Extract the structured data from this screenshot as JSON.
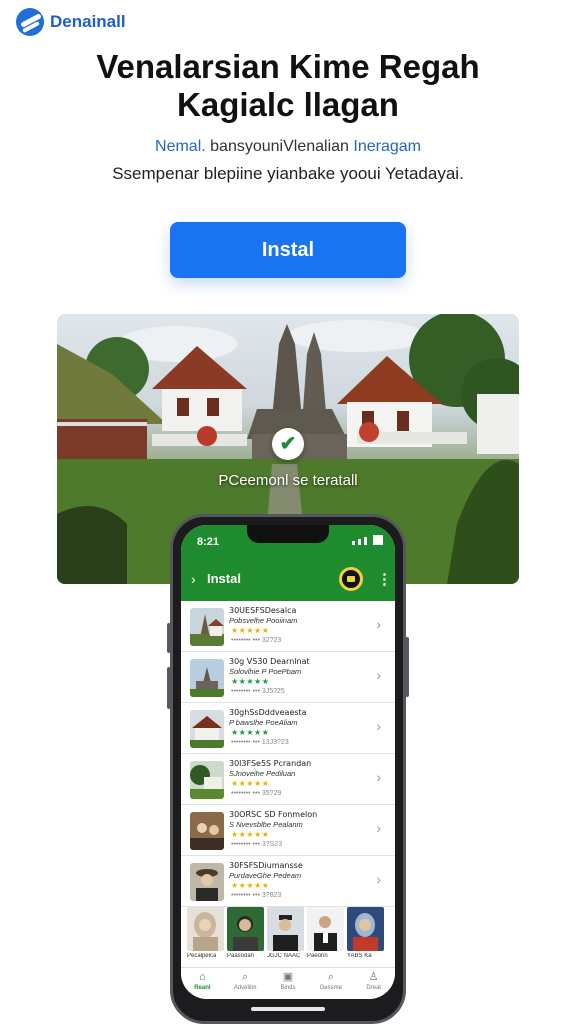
{
  "brand": {
    "name": "Denainall",
    "icon": "brand-logo-icon",
    "color": "#1f5fc4"
  },
  "headline": {
    "line1": "Venalarsian Kime Regah",
    "line2": "Kagialc llagan"
  },
  "subtitle": {
    "lead": "Nemal.",
    "middle": " bansyouniVlenalian ",
    "accent": "Ineragam"
  },
  "subtitle2": "Ssempenar blepiine yianbake yooui Yetadayai.",
  "install_button": {
    "label": "Instal",
    "color": "#1a73f0"
  },
  "hero": {
    "caption": "PCeemonl se teratall",
    "check_icon": "check-icon",
    "check_glyph": "✔"
  },
  "phone": {
    "status_time": "8:21",
    "appbar": {
      "back_glyph": "›",
      "title": "Instal",
      "more_glyph": "⋮",
      "accent": "#1e8c2e"
    },
    "list": [
      {
        "title": "30UESFSDesalca",
        "subtitle": "Pobsvelhe Pooiinam",
        "rating": "★★★★★",
        "meta": "•••••••• ••• 32?23",
        "star_color": "#e8b400"
      },
      {
        "title": "30g VS30 Dearnlnat",
        "subtitle": "Solovlhie P PoePbam",
        "rating": "★★★★★",
        "meta": "•••••••• ••• 3J5?25",
        "star_color": "#1e9a3a"
      },
      {
        "title": "30ghSsDddveaesta",
        "subtitle": "P bawslhe PoeAliam",
        "rating": "★★★★★",
        "meta": "•••••••• ••• 13J3?23",
        "star_color": "#1e9a3a"
      },
      {
        "title": "30l3FSe5S Pcrandan",
        "subtitle": "SJnoveihe Pediluan",
        "rating": "★★★★★",
        "meta": "•••••••• ••• 35?29",
        "star_color": "#e8b400"
      },
      {
        "title": "30ORSC SD Fonmelon",
        "subtitle": "S Nvevsblhe Pealanm",
        "rating": "★★★★★",
        "meta": "•••••••• ••• 3?S23",
        "star_color": "#e8b400"
      },
      {
        "title": "30FSFSDiumansse",
        "subtitle": "PurdaveGhe Pedeam",
        "rating": "★★★★★",
        "meta": "•••••••• ••• 3?823",
        "star_color": "#e8b400"
      }
    ],
    "people": [
      {
        "caption": "Pecalpelca"
      },
      {
        "caption": "Paasodan"
      },
      {
        "caption": "JGJC NAAC"
      },
      {
        "caption": "Paeonn"
      },
      {
        "caption": "YABS Ka"
      }
    ],
    "tabs": [
      {
        "label": "Reanl",
        "glyph": "⌂",
        "icon": "home-icon",
        "active": true
      },
      {
        "label": "Adveliim",
        "glyph": "⌕",
        "icon": "search-icon",
        "active": false
      },
      {
        "label": "Binds",
        "glyph": "▣",
        "icon": "image-icon",
        "active": false
      },
      {
        "label": "Gessme",
        "glyph": "⌕",
        "icon": "search-icon",
        "active": false
      },
      {
        "label": "Dreal",
        "glyph": "♙",
        "icon": "profile-icon",
        "active": false
      }
    ]
  }
}
